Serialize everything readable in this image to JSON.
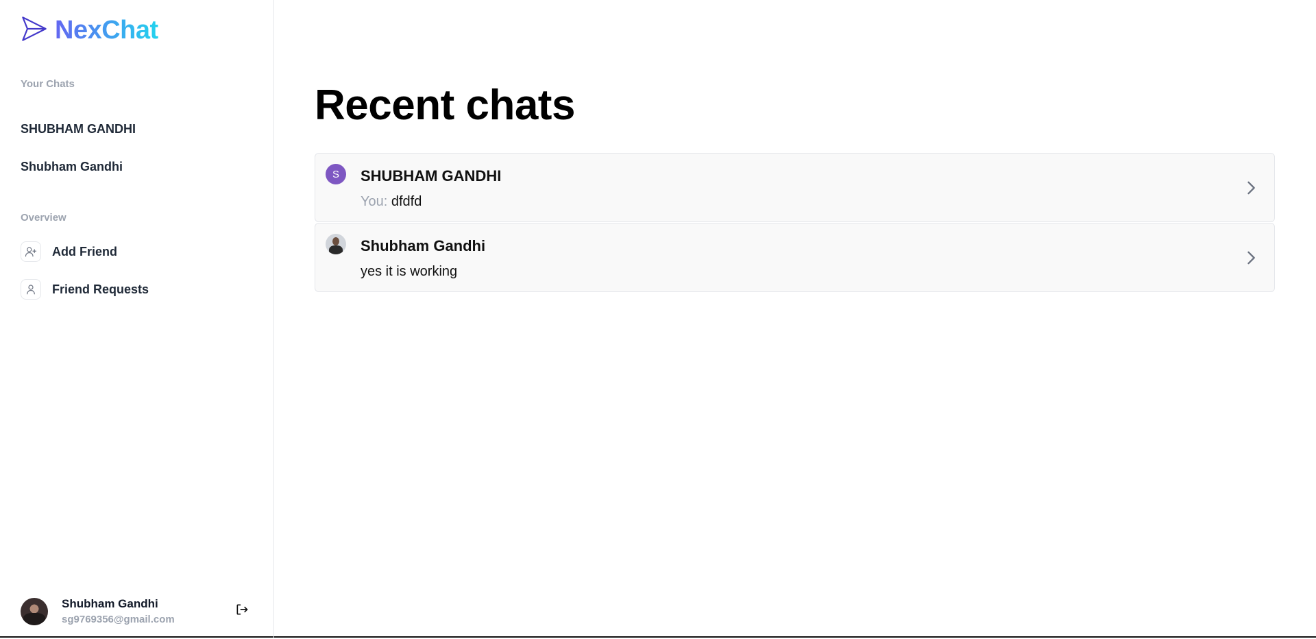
{
  "brand": {
    "name": "NexChat"
  },
  "sidebar": {
    "your_chats_label": "Your Chats",
    "chats": [
      {
        "label": "SHUBHAM GANDHI"
      },
      {
        "label": "Shubham Gandhi"
      }
    ],
    "overview_label": "Overview",
    "overview_items": [
      {
        "label": "Add Friend",
        "icon": "user-plus-icon"
      },
      {
        "label": "Friend Requests",
        "icon": "user-icon"
      }
    ],
    "profile": {
      "name": "Shubham Gandhi",
      "email": "sg9769356@gmail.com"
    }
  },
  "main": {
    "title": "Recent chats",
    "chats": [
      {
        "name": "SHUBHAM GANDHI",
        "avatar_letter": "S",
        "prefix": "You: ",
        "message": "dfdfd"
      },
      {
        "name": "Shubham Gandhi",
        "avatar_letter": "",
        "prefix": "",
        "message": "yes it is working"
      }
    ]
  },
  "colors": {
    "brand_gradient_start": "#6366f1",
    "brand_gradient_end": "#22d3ee",
    "avatar_purple": "#7e57c2",
    "muted_text": "#9ca3af",
    "row_background": "#f9f9f9"
  }
}
